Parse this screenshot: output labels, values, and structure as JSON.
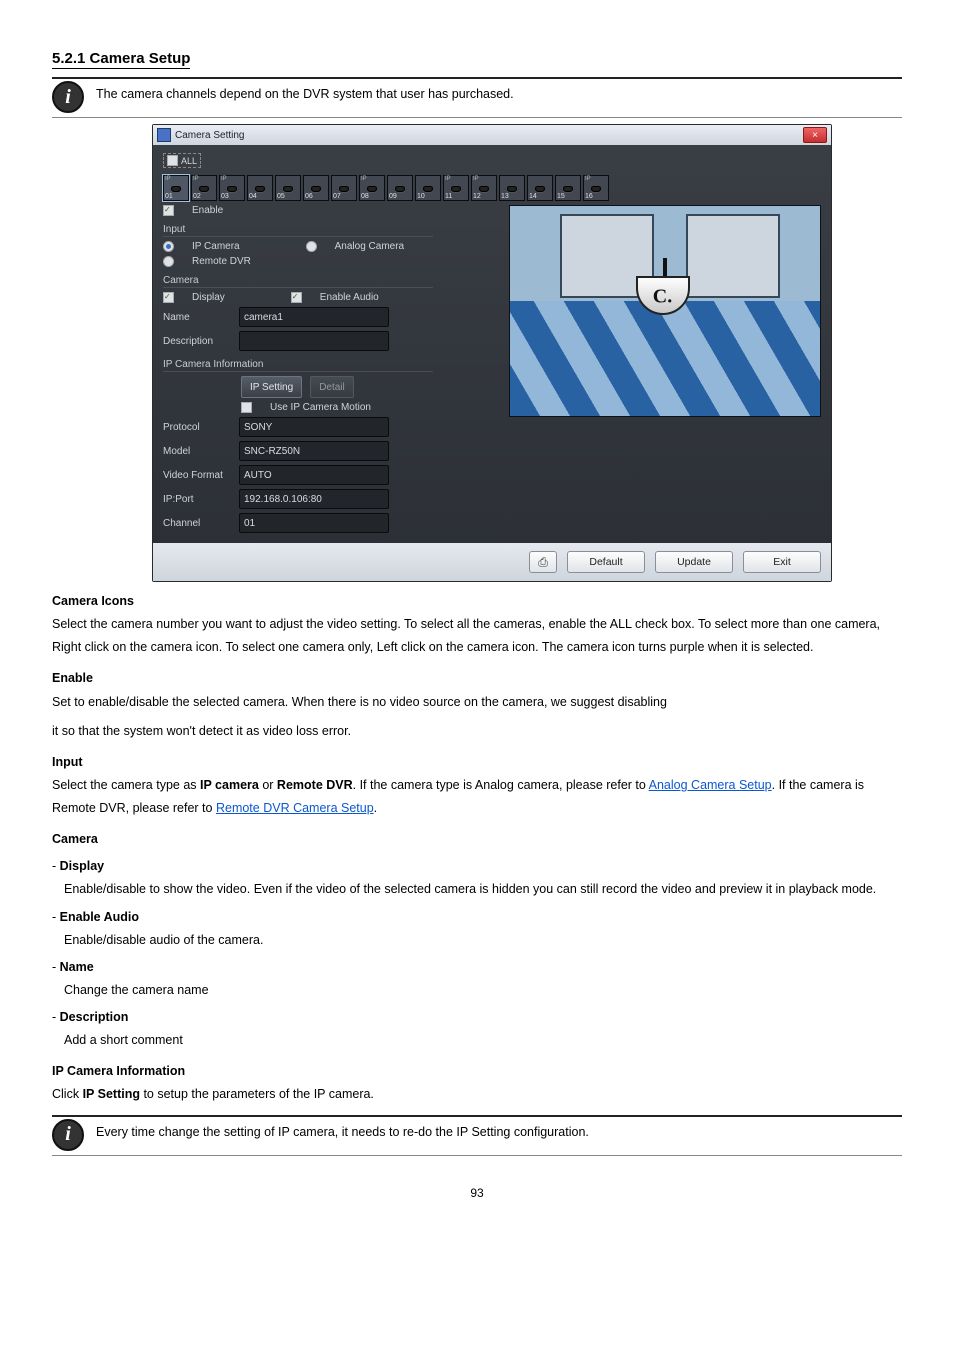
{
  "section": {
    "number": "5.2.1",
    "title": "Camera Setup",
    "heading_combined": "5.2.1 Camera Setup",
    "note": "The camera channels depend on the DVR system that user has purchased."
  },
  "window": {
    "title": "Camera Setting",
    "all_label": "ALL",
    "close_symbol": "×",
    "channels": [
      "01",
      "02",
      "03",
      "04",
      "05",
      "06",
      "07",
      "08",
      "09",
      "10",
      "11",
      "12",
      "13",
      "14",
      "15",
      "16"
    ],
    "enable_label": "Enable",
    "enable_checked": true,
    "groups": {
      "input": "Input",
      "camera": "Camera",
      "ipinfo": "IP Camera Information"
    },
    "input": {
      "ip_camera": "IP Camera",
      "analog_camera": "Analog Camera",
      "remote_dvr": "Remote DVR",
      "selected": "ip"
    },
    "camera": {
      "display_label": "Display",
      "display_checked": true,
      "enable_audio_label": "Enable Audio",
      "enable_audio_checked": true,
      "name_label": "Name",
      "name_value": "camera1",
      "description_label": "Description",
      "description_value": ""
    },
    "ipinfo": {
      "ip_setting_btn": "IP Setting",
      "detail_btn": "Detail",
      "use_motion_label": "Use IP Camera Motion",
      "use_motion_checked": false,
      "protocol_label": "Protocol",
      "protocol_value": "SONY",
      "model_label": "Model",
      "model_value": "SNC-RZ50N",
      "video_format_label": "Video Format",
      "video_format_value": "AUTO",
      "ipport_label": "IP:Port",
      "ipport_value": "192.168.0.106:80",
      "channel_label": "Channel",
      "channel_value": "01"
    },
    "footer": {
      "printer_icon": "printer-icon",
      "default": "Default",
      "update": "Update",
      "exit": "Exit"
    }
  },
  "body": {
    "camera_icons": "Camera Icons",
    "camera_icons_text": "Select the camera number you want to adjust the video setting. To select all the cameras, enable the ALL check box. To select more than one camera, Right click on the camera icon. To select one camera only, Left click on the camera icon. The camera icon turns purple when it is selected.",
    "enable": "Enable",
    "enable_text_1": "Set to enable/disable the selected camera. When there is no video source on the camera, we suggest disabling",
    "enable_text_2": "it so that the system won't detect it as video loss error.",
    "input": "Input",
    "input_text_1": "Select the camera type as ",
    "input_text_link_ip": "IP camera",
    "input_text_2": " or ",
    "input_text_b_remote": "Remote DVR",
    "input_text_3": ". If the camera type is Analog camera, please refer to ",
    "input_text_link_analog": "Analog Camera Setup",
    "input_text_4": ". If the camera is Remote DVR, please refer to ",
    "input_text_link_remote": "Remote DVR Camera Setup",
    "input_text_5": ".",
    "camera_group": "Camera",
    "display": "Display",
    "display_text": "Enable/disable to show the video. Even if the video of the selected camera is hidden you can still record the video and preview it in playback mode.",
    "enable_audio": "Enable Audio",
    "enable_audio_text": "Enable/disable audio of the camera.",
    "name": "Name",
    "name_text": "Change the camera name",
    "description": "Description",
    "description_text": "Add a short comment",
    "ipcam_info": "IP Camera Information",
    "ipcam_info_text_1": "Click ",
    "ipcam_info_text_b": "IP Setting",
    "ipcam_info_text_2": " to setup the parameters of the IP camera.",
    "ipcam_note": "Every time change the setting of IP camera, it needs to re-do the IP Setting configuration."
  },
  "page_number": "93"
}
